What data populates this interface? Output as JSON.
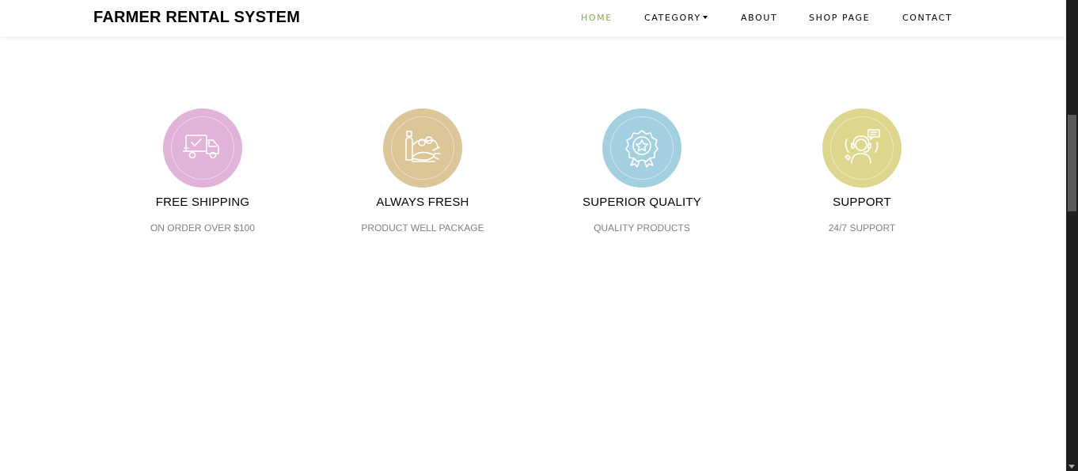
{
  "brand": "FARMER RENTAL SYSTEM",
  "nav": {
    "items": [
      {
        "label": "HOME",
        "active": true
      },
      {
        "label": "CATEGORY",
        "dropdown": true
      },
      {
        "label": "ABOUT"
      },
      {
        "label": "SHOP PAGE"
      },
      {
        "label": "CONTACT"
      }
    ],
    "active_color": "#82ae46"
  },
  "services": [
    {
      "title": "FREE SHIPPING",
      "subtitle": "ON ORDER OVER $100",
      "icon": "delivery-truck-icon",
      "color": "#e1b3d9"
    },
    {
      "title": "ALWAYS FRESH",
      "subtitle": "PRODUCT WELL PACKAGE",
      "icon": "fresh-produce-icon",
      "color": "#dcc698"
    },
    {
      "title": "SUPERIOR QUALITY",
      "subtitle": "QUALITY PRODUCTS",
      "icon": "quality-badge-icon",
      "color": "#a3d0e0"
    },
    {
      "title": "SUPPORT",
      "subtitle": "24/7 SUPPORT",
      "icon": "customer-support-icon",
      "color": "#ddd78e"
    }
  ]
}
